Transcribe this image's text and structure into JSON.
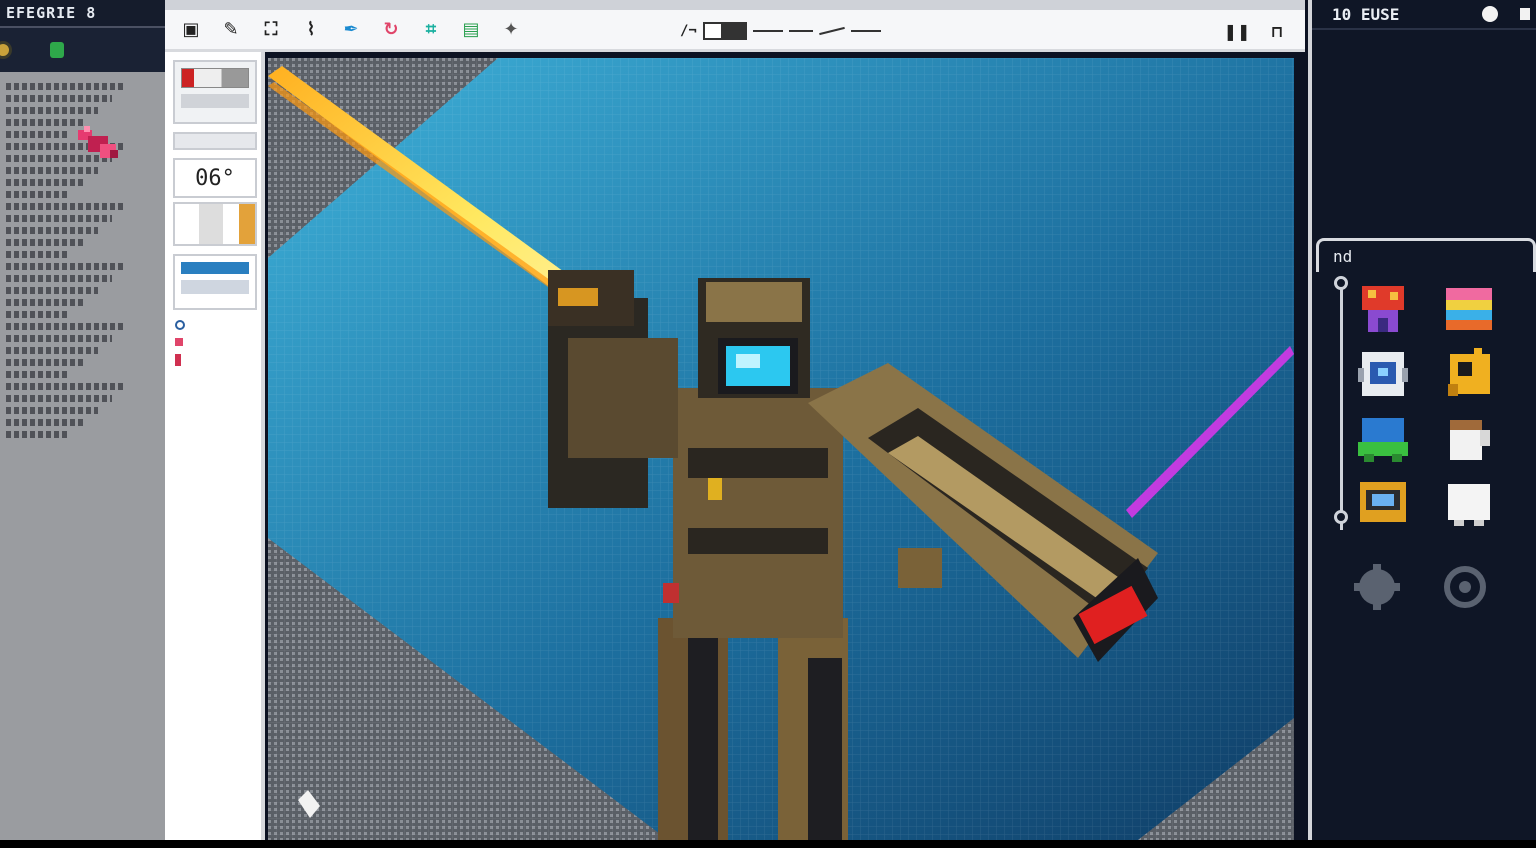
{
  "left_panel": {
    "title": "EFEGRIE 8",
    "toolbar_icons": [
      "gear-icon",
      "layer-icon"
    ],
    "list_rows": 30
  },
  "toolbar": {
    "tools": [
      "select-icon",
      "brush-icon",
      "fill-icon",
      "eyedropper-icon",
      "pen-icon",
      "rotate-icon",
      "crop-icon",
      "image-icon",
      "wand-icon"
    ],
    "right_icons": [
      "pause-icon",
      "lock-icon"
    ]
  },
  "tool_strip": {
    "zoom_label": "06°"
  },
  "right_panel": {
    "title": "10 EUSE",
    "palette_label": "nd",
    "sprites": [
      "mushroom-house-sprite",
      "rainbow-cake-sprite",
      "robot-head-sprite",
      "yellow-block-sprite",
      "green-creature-sprite",
      "mug-sprite",
      "chest-sprite",
      "white-blob-sprite",
      "gear-sprite",
      "swirl-sprite"
    ]
  },
  "colors": {
    "canvas_bg": "#1b5f8c",
    "laser": "#ffd23c",
    "laser_purple": "#c23be0",
    "armor": "#6e5a38",
    "visor": "#2cc8f0",
    "muzzle": "#e02020"
  }
}
